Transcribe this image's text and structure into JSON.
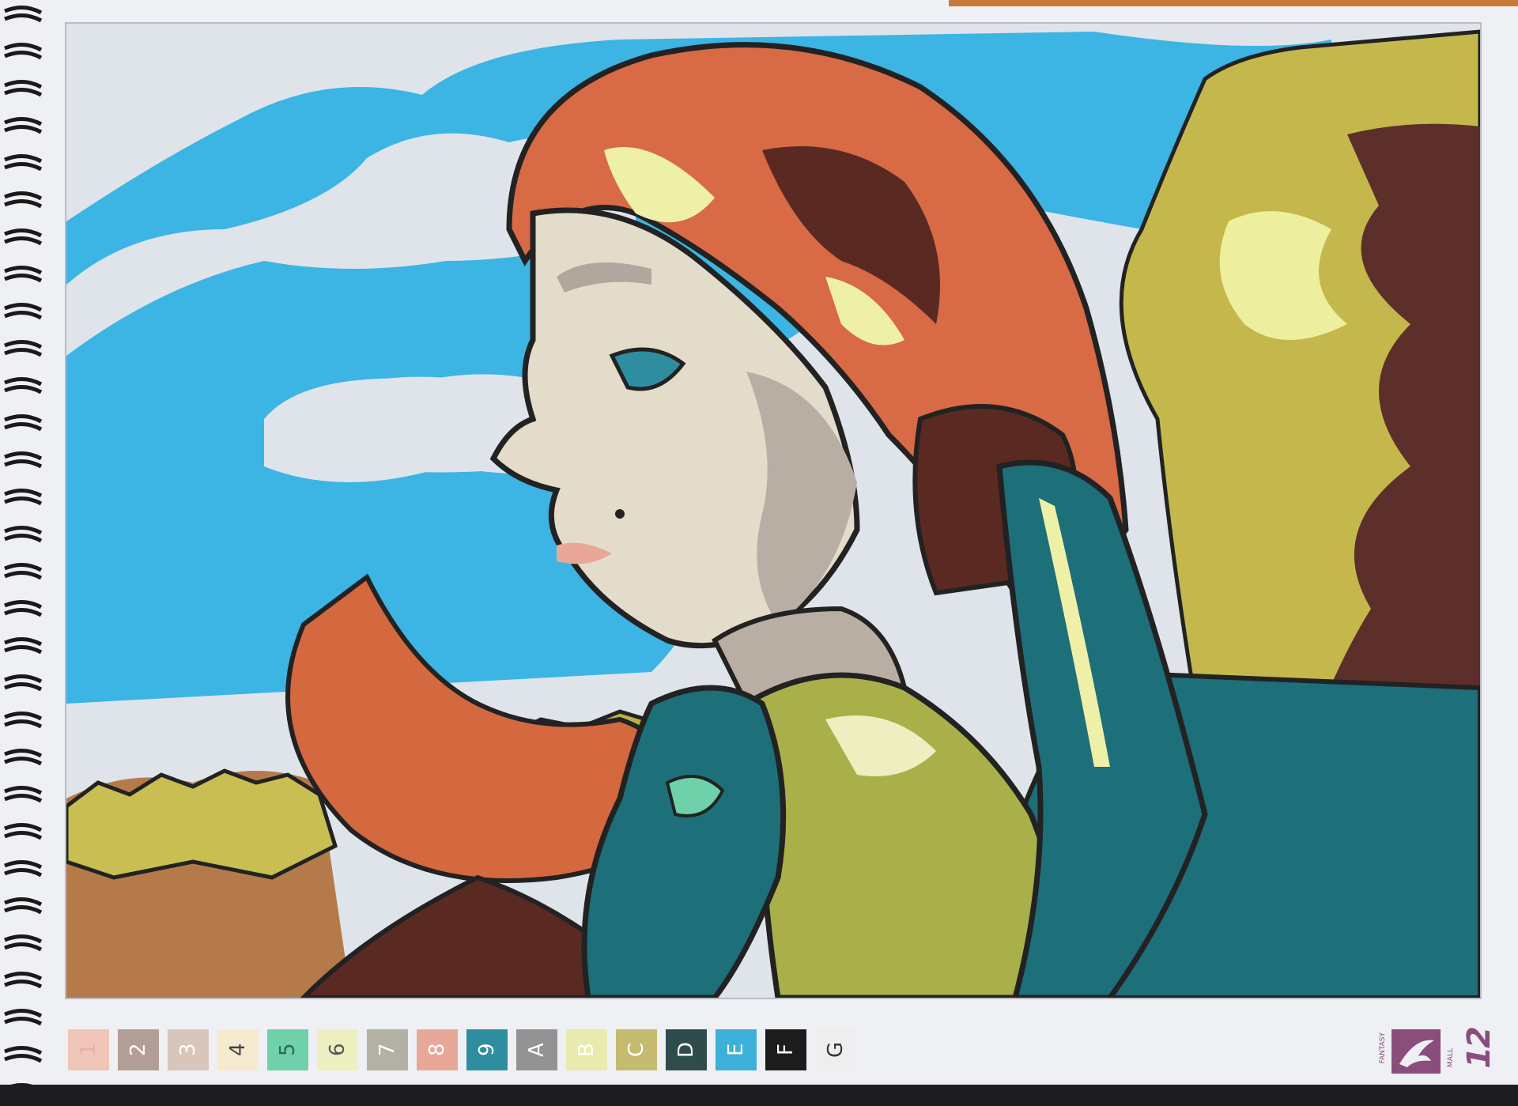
{
  "palette": [
    {
      "code": "1",
      "color": "#efc6b7",
      "text": "#e7b4a3"
    },
    {
      "code": "2",
      "color": "#b39d97",
      "text": "#ffffff"
    },
    {
      "code": "3",
      "color": "#d9c6bb",
      "text": "#ffffff"
    },
    {
      "code": "4",
      "color": "#f5eacd",
      "text": "#444444"
    },
    {
      "code": "5",
      "color": "#6ed1a9",
      "text": "#2c6b55"
    },
    {
      "code": "6",
      "color": "#eeefc0",
      "text": "#555555"
    },
    {
      "code": "7",
      "color": "#b3b1a3",
      "text": "#ffffff"
    },
    {
      "code": "8",
      "color": "#e9a897",
      "text": "#ffffff"
    },
    {
      "code": "9",
      "color": "#2f8da0",
      "text": "#ffffff"
    },
    {
      "code": "A",
      "color": "#939394",
      "text": "#ffffff"
    },
    {
      "code": "B",
      "color": "#e9eaad",
      "text": "#ffffff"
    },
    {
      "code": "C",
      "color": "#c4bb6e",
      "text": "#ffffff"
    },
    {
      "code": "D",
      "color": "#2f4b4c",
      "text": "#ffffff"
    },
    {
      "code": "E",
      "color": "#3cb0d8",
      "text": "#ffffff"
    },
    {
      "code": "F",
      "color": "#1c1c1c",
      "text": "#ffffff"
    },
    {
      "code": "G",
      "color": "#eeeeee",
      "text": "#333333"
    }
  ],
  "brand": {
    "line1": "FANTASY",
    "line2": "MALL"
  },
  "page_number": "12",
  "colors": {
    "sky": "#3cb4e4",
    "cloud": "#dfe4ea",
    "hair": "#d86a46",
    "hair_dark": "#5a2a22",
    "highlight": "#eef0a8",
    "skin": "#e4dccb",
    "skin_shade": "#b8aea4",
    "cape": "#1d6f7a",
    "tunic": "#a9b04a",
    "tree": "#c2b54e",
    "tree_dark": "#5d2f2a"
  }
}
